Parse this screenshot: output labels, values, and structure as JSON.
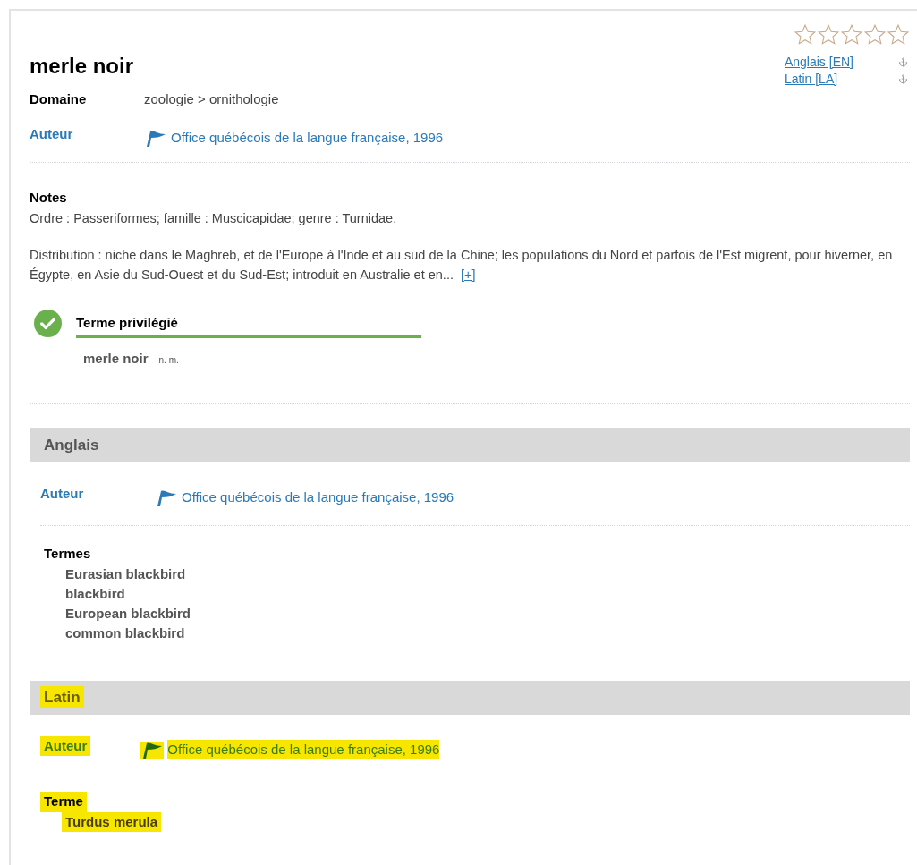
{
  "rating": {
    "stars": 0
  },
  "title": "merle noir",
  "languages": [
    {
      "label": "Anglais [EN]"
    },
    {
      "label": "Latin [LA]"
    }
  ],
  "domain": {
    "label": "Domaine",
    "value": "zoologie > ornithologie"
  },
  "author": {
    "label": "Auteur",
    "value": "Office québécois de la langue française, 1996"
  },
  "notes": {
    "label": "Notes",
    "paragraphs": [
      "Ordre : Passeriformes; famille : Muscicapidae; genre : Turnidae.",
      "Distribution : niche dans le Maghreb, et de l'Europe à l'Inde et au sud de la Chine; les populations du Nord et parfois de l'Est migrent, pour hiverner, en Égypte, en Asie du Sud-Ouest et du Sud-Est; introduit en Australie et en..."
    ],
    "more": "[+]"
  },
  "preferred_term": {
    "label": "Terme privilégié",
    "term": "merle noir",
    "grammar": "n. m."
  },
  "sections": [
    {
      "heading": "Anglais",
      "highlighted": false,
      "author_label": "Auteur",
      "author": "Office québécois de la langue française, 1996",
      "terms_label": "Termes",
      "terms": [
        "Eurasian blackbird",
        "blackbird",
        "European blackbird",
        "common blackbird"
      ]
    },
    {
      "heading": "Latin",
      "highlighted": true,
      "author_label": "Auteur",
      "author": "Office québécois de la langue française, 1996",
      "terms_label": "Terme",
      "terms": [
        "Turdus merula"
      ]
    }
  ]
}
